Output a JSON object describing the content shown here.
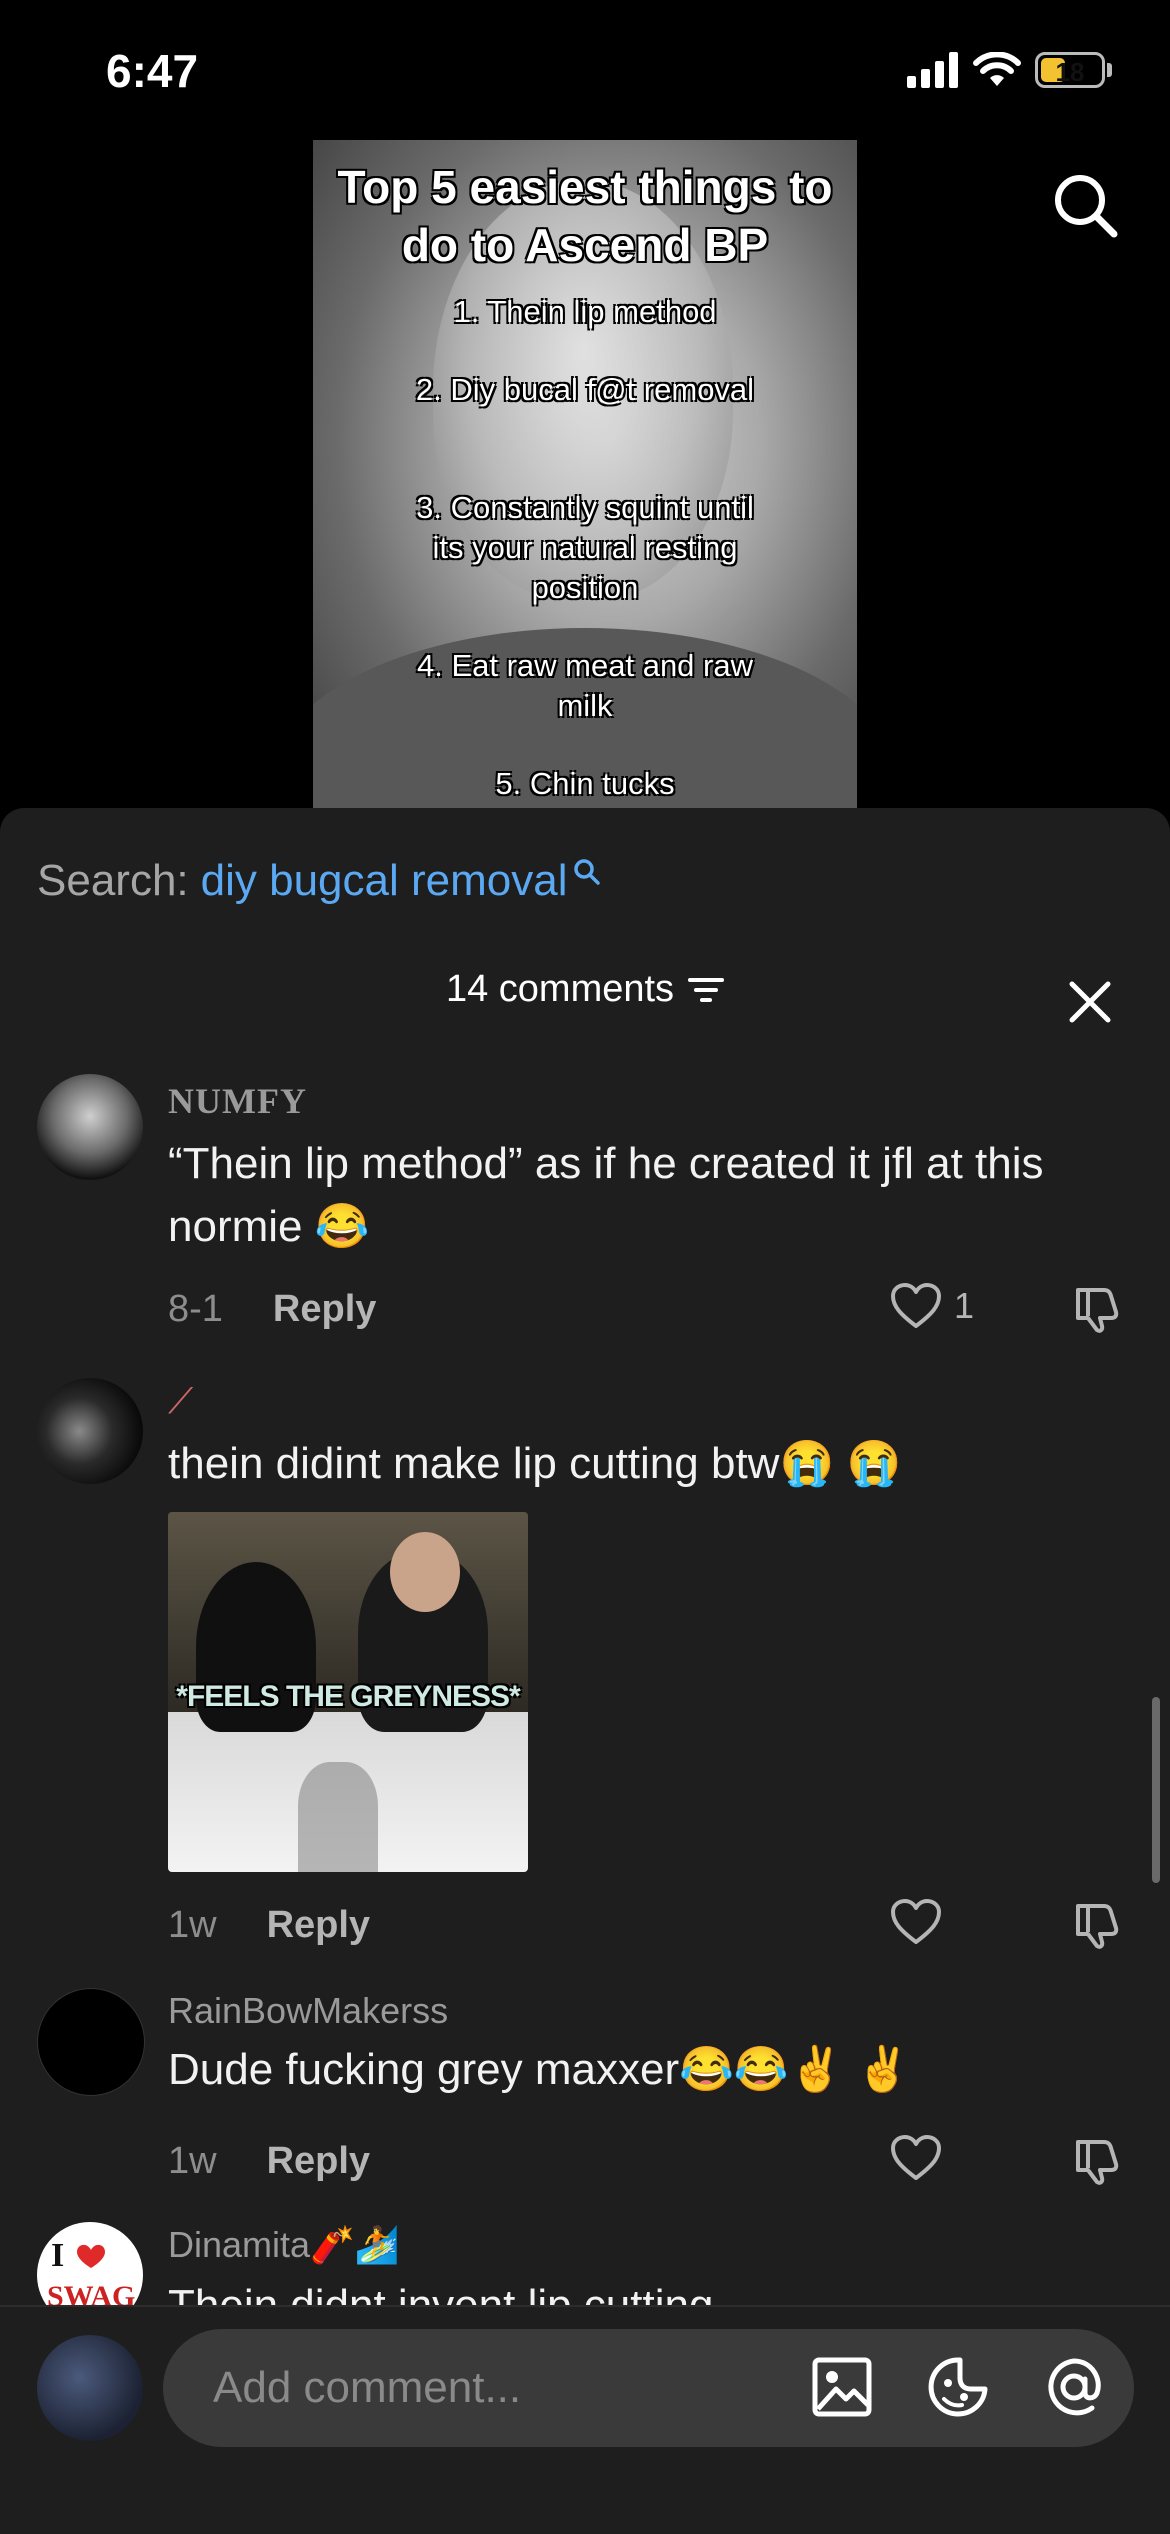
{
  "status_bar": {
    "time": "6:47",
    "battery": "18"
  },
  "video": {
    "title": "Top 5 easiest things to do to Ascend BP",
    "items": [
      "1. Thein lip method",
      "2. Diy bucal f@t removal",
      "3. Constantly squint until its your natural resting position",
      "4. Eat raw meat and raw milk",
      "5. Chin tucks"
    ]
  },
  "search": {
    "label": "Search:",
    "query": "diy bugcal removal"
  },
  "comments_header": {
    "count_label": "14 comments"
  },
  "comments": [
    {
      "username": "NUMFY",
      "text": "“Thein lip method” as if he created it jfl at this normie 😂",
      "time": "8-1",
      "reply_label": "Reply",
      "likes": "1"
    },
    {
      "username": "⟋",
      "text": "thein didint make lip cutting btw😭 😭",
      "gif_caption": "*FEELS THE GREYNESS*",
      "time": "1w",
      "reply_label": "Reply"
    },
    {
      "username": "RainBowMakerss",
      "text": "Dude fucking grey maxxer😂😂✌️ ✌️",
      "time": "1w",
      "reply_label": "Reply"
    },
    {
      "username": "Dinamita🧨🏄",
      "text": "Thein didnt invent lip cutting",
      "avatar_text": "I ❤ SWAG"
    }
  ],
  "composer": {
    "placeholder": "Add comment..."
  },
  "colors": {
    "accent_blue": "#5aa9f2",
    "sheet_bg": "#1e1e1e",
    "battery": "#f2c230"
  }
}
